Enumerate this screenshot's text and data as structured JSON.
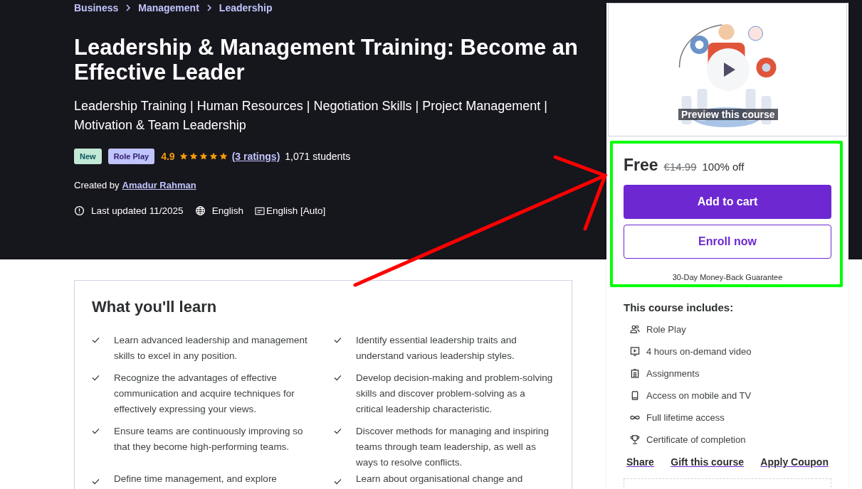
{
  "breadcrumbs": [
    "Business",
    "Management",
    "Leadership"
  ],
  "title": "Leadership & Management Training: Become an Effective Leader",
  "subtitle": "Leadership Training | Human Resources | Negotiation Skills | Project Management | Motivation & Team Leadership",
  "badges": [
    {
      "label": "New",
      "kind": "new"
    },
    {
      "label": "Role Play",
      "kind": "category"
    }
  ],
  "rating": {
    "score": "4.9",
    "stars": 5,
    "ratings_link": "(3 ratings)",
    "students": "1,071 students"
  },
  "creator": {
    "prefix": "Created by",
    "name": "Amadur Rahman"
  },
  "meta": [
    {
      "kind": "updated",
      "text": "Last updated 11/2025"
    },
    {
      "kind": "language",
      "text": "English"
    },
    {
      "kind": "captions",
      "text": "English [Auto]"
    }
  ],
  "learn": {
    "heading": "What you'll learn",
    "items": [
      "Learn advanced leadership and management skills to excel in any position.",
      "Identify essential leadership traits and understand various leadership styles.",
      "Recognize the advantages of effective communication and acquire techniques for effectively expressing your views.",
      "Develop decision-making and problem-solving skills and discover problem-solving as a critical leadership characteristic.",
      "Ensure teams are continuously improving so that they become high-performing teams.",
      "Discover methods for managing and inspiring teams through team leadership, as well as ways to resolve conflicts.",
      "Define time management, and explore",
      "Learn about organisational change and"
    ]
  },
  "sidebar": {
    "preview_label": "Preview this course",
    "price": {
      "current": "Free",
      "original": "€14.99",
      "discount": "100% off"
    },
    "buttons": [
      {
        "label": "Add to cart",
        "kind": "primary"
      },
      {
        "label": "Enroll now",
        "kind": "secondary"
      }
    ],
    "guarantee": "30-Day Money-Back Guarantee",
    "includes_heading": "This course includes:",
    "includes": [
      {
        "kind": "people",
        "text": "Role Play"
      },
      {
        "kind": "video",
        "text": "4 hours on-demand video"
      },
      {
        "kind": "assignment",
        "text": "Assignments"
      },
      {
        "kind": "mobile",
        "text": "Access on mobile and TV"
      },
      {
        "kind": "infinity",
        "text": "Full lifetime access"
      },
      {
        "kind": "trophy",
        "text": "Certificate of completion"
      }
    ],
    "links": [
      "Share",
      "Gift this course",
      "Apply Coupon"
    ]
  },
  "annotation": {
    "highlight": true,
    "arrow": true
  }
}
